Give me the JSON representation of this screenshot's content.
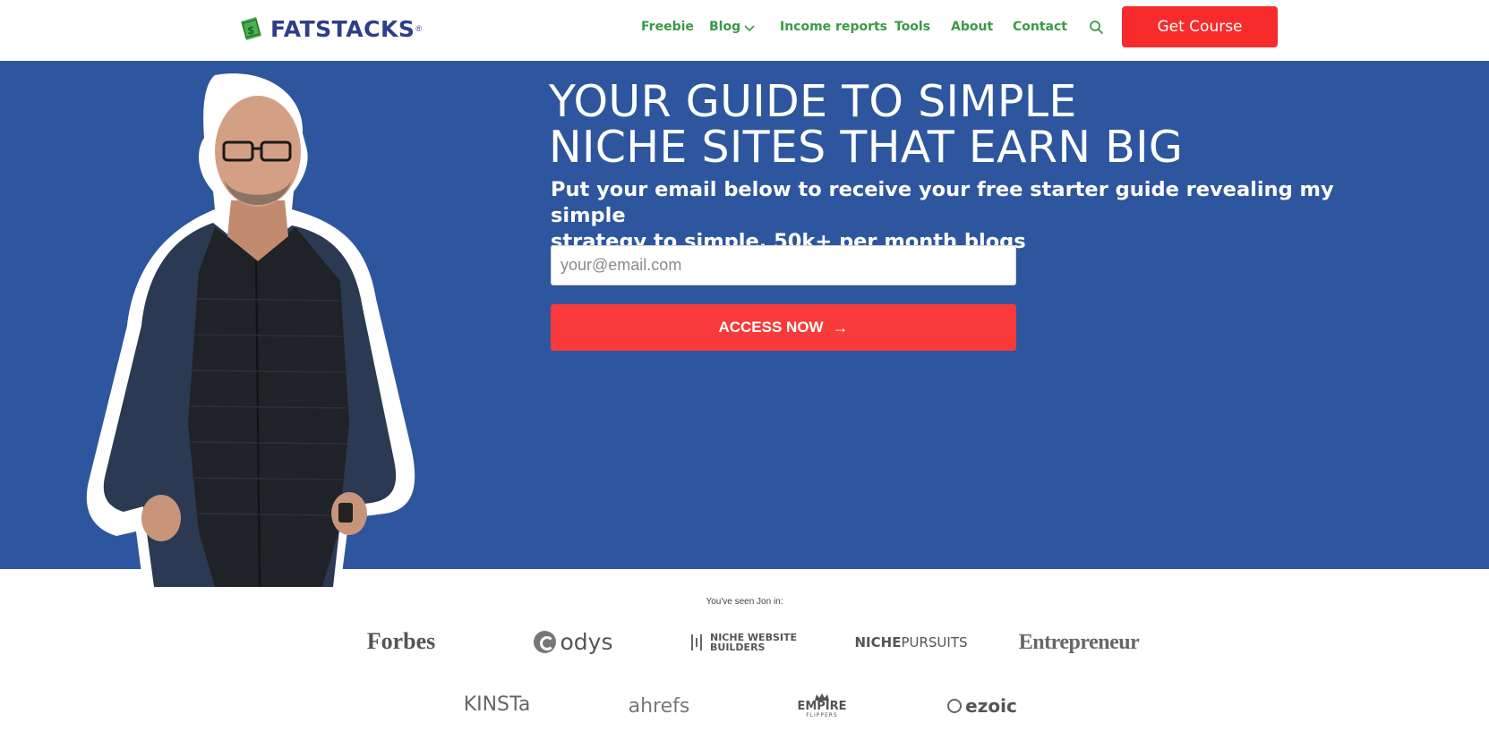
{
  "header": {
    "logo_text": "FATSTACKS",
    "logo_registered": "®",
    "nav": [
      "Freebie",
      "Blog",
      "Income reports",
      "Tools",
      "About",
      "Contact"
    ],
    "cta_label": "Get Course"
  },
  "hero": {
    "title_line1": "YOUR GUIDE TO SIMPLE",
    "title_line2": "NICHE SITES THAT EARN BIG",
    "subtitle_line1": "Put your email below to receive your free starter guide revealing my simple",
    "subtitle_line2": "strategy to simple, 50k+ per month blogs",
    "email_placeholder": "your@email.com",
    "button_label": "ACCESS NOW",
    "button_arrow": "→"
  },
  "seen_in": {
    "label": "You've seen Jon in:",
    "brands": {
      "forbes": "Forbes",
      "odys": "odys",
      "nwb_line1": "NICHE WEBSITE",
      "nwb_line2": "BUILDERS",
      "np_bold": "NICHE",
      "np_light": "PURSUITS",
      "entrepreneur": "Entrepreneur",
      "kinsta": "KINSTa",
      "ahrefs": "ahrefs",
      "empire_line1": "EMPIRE",
      "empire_line2": "FLIPPERS",
      "ezoic": "ezoic"
    }
  },
  "colors": {
    "brand_navy": "#2f3d8c",
    "nav_green": "#3a9a46",
    "hero_blue": "#2e569e",
    "cta_red": "#f72b2b"
  }
}
